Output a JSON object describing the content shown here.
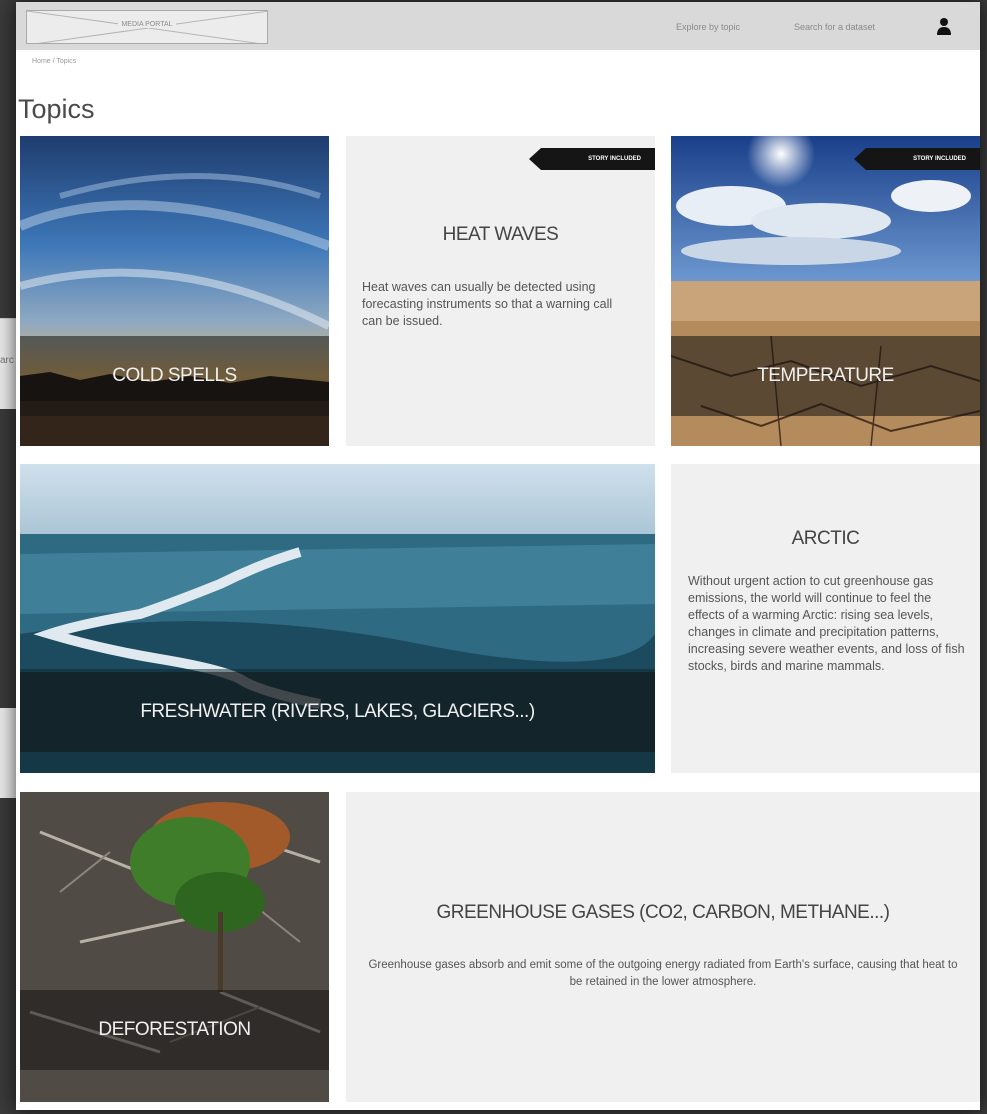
{
  "header": {
    "logo_text": "MEDIA PORTAL",
    "nav": [
      "Explore by topic",
      "Search for a dataset"
    ],
    "user_icon": "user-icon"
  },
  "breadcrumb": "Home / Topics",
  "page_title": "Topics",
  "background_window_text": "arc",
  "badge_label": "STORY INCLUDED",
  "topics": [
    {
      "id": "cold-spells",
      "label": "COLD SPELLS"
    },
    {
      "id": "heat-waves",
      "title": "HEAT WAVES",
      "description": "Heat waves can usually be detected using forecasting instruments so that a warning call can be issued.",
      "story_included": true
    },
    {
      "id": "temperature",
      "label": "TEMPERATURE",
      "story_included": true
    },
    {
      "id": "freshwater",
      "label": "FRESHWATER (RIVERS, LAKES, GLACIERS...)"
    },
    {
      "id": "arctic",
      "title": "ARCTIC",
      "description": "Without urgent action to cut greenhouse gas emissions, the world will continue to feel the effects of a warming Arctic: rising sea levels, changes in climate and precipitation patterns, increasing severe weather events, and loss of fish stocks, birds and marine mammals."
    },
    {
      "id": "deforestation",
      "label": "DEFORESTATION"
    },
    {
      "id": "greenhouse-gases",
      "title": "GREENHOUSE GASES (CO2, CARBON, METHANE...)",
      "description": "Greenhouse gases absorb and emit some of the outgoing energy radiated from Earth's surface, causing that heat to be retained in the lower atmosphere."
    }
  ],
  "colors": {
    "header_bg": "#d9d9d9",
    "card_bg": "#f0f0f0",
    "badge_bg": "#151515"
  }
}
